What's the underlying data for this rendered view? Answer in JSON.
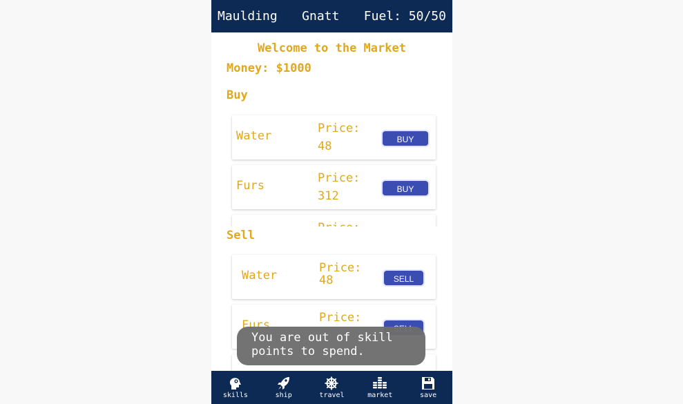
{
  "header": {
    "captain": "Maulding",
    "ship": "Gnatt",
    "fuel": "Fuel: 50/50"
  },
  "market": {
    "title": "Welcome to the Market",
    "money": "Money: $1000",
    "buy_heading": "Buy",
    "sell_heading": "Sell",
    "buy_items": [
      {
        "name": "Water",
        "price_label": "Price:",
        "price": "48",
        "button": "BUY"
      },
      {
        "name": "Furs",
        "price_label": "Price:",
        "price": "312",
        "button": "BUY"
      },
      {
        "name": "",
        "price_label": "Price:",
        "price": "",
        "button": ""
      }
    ],
    "sell_items": [
      {
        "name": "Water",
        "price_label": "Price:",
        "price": "48",
        "button": "SELL"
      },
      {
        "name": "Furs",
        "price_label": "Price:",
        "price": "",
        "button": "SELL"
      }
    ]
  },
  "toast": {
    "message": "You are out of skill points to spend."
  },
  "nav": [
    {
      "label": "skills",
      "icon": "head-gear-icon"
    },
    {
      "label": "ship",
      "icon": "rocket-icon"
    },
    {
      "label": "travel",
      "icon": "ship-wheel-icon"
    },
    {
      "label": "market",
      "icon": "coin-stack-icon"
    },
    {
      "label": "save",
      "icon": "floppy-disk-icon"
    }
  ],
  "colors": {
    "accent": "#e0a81c",
    "header_bg": "#0d2a55",
    "button": "#3b4db0"
  }
}
